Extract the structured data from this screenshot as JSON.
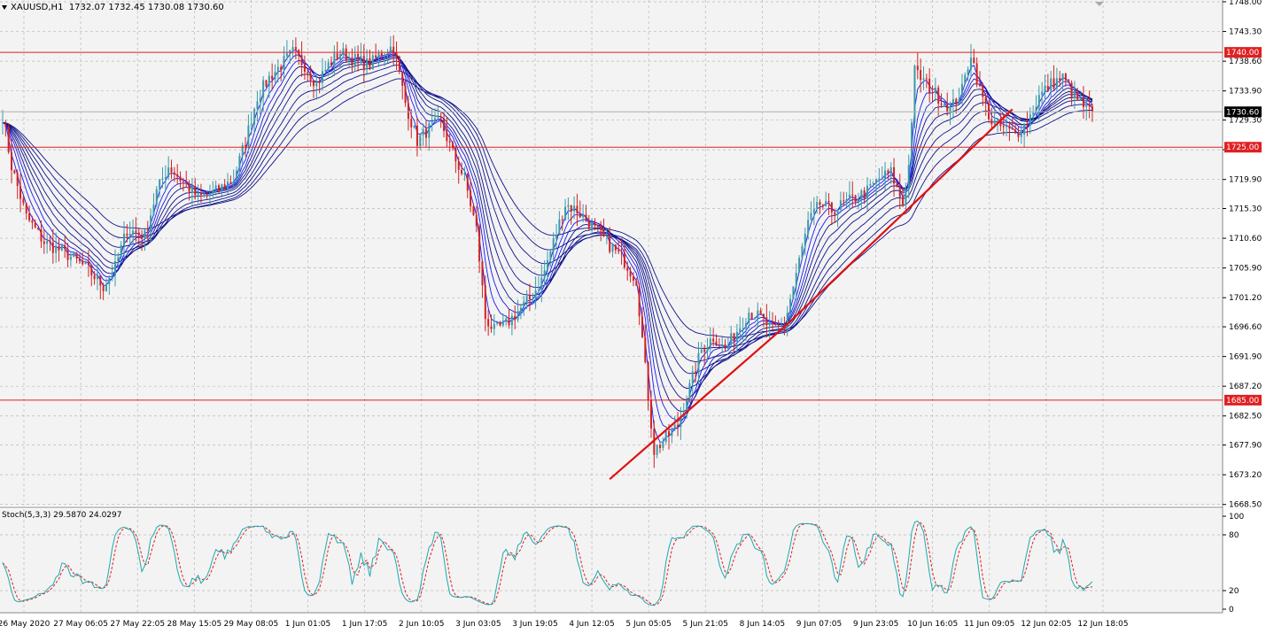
{
  "header": {
    "symbol": "XAUUSD,H1",
    "ohlc": "1732.07 1732.45 1730.08 1730.60"
  },
  "stoch_header": "Stoch(5,3,3) 29.5870 24.0297",
  "colors": {
    "background": "#f3f3f3",
    "grid": "#b9b9b9",
    "candle_up": "#3a9ba8",
    "candle_down": "#d22222",
    "ribbon": "#10128c",
    "fast_ma": "#1a1aee",
    "level_line": "#e02020",
    "trendline": "#e01010",
    "current_price": "#b0b0b0",
    "stoch_main": "#20a8b0",
    "stoch_signal": "#e02020"
  },
  "chart_data": [
    {
      "type": "line",
      "kind": "candlestick-with-ma-ribbon",
      "title": "",
      "price_axis": {
        "range": [
          1668.6,
          1748.0
        ],
        "ticks": [
          "1748.00",
          "1743.30",
          "1738.60",
          "1733.90",
          "1729.30",
          "1724.60",
          "1719.90",
          "1715.30",
          "1710.60",
          "1705.90",
          "1701.20",
          "1696.60",
          "1691.90",
          "1687.20",
          "1682.50",
          "1677.90",
          "1673.20",
          "1668.50"
        ]
      },
      "time_axis": {
        "labels": [
          "26 May 2020",
          "27 May 06:05",
          "27 May 22:05",
          "28 May 15:05",
          "29 May 08:05",
          "1 Jun 01:05",
          "1 Jun 17:05",
          "2 Jun 10:05",
          "3 Jun 03:05",
          "3 Jun 19:05",
          "4 Jun 12:05",
          "5 Jun 05:05",
          "5 Jun 21:05",
          "8 Jun 14:05",
          "9 Jun 07:05",
          "9 Jun 23:05",
          "10 Jun 16:05",
          "11 Jun 09:05",
          "12 Jun 02:05",
          "12 Jun 18:05"
        ]
      },
      "levels": [
        {
          "value": 1740.0,
          "label": "1740.00"
        },
        {
          "value": 1725.0,
          "label": "1725.00"
        },
        {
          "value": 1685.0,
          "label": "1685.00"
        }
      ],
      "current_price": {
        "value": 1730.6,
        "label": "1730.60"
      },
      "trendlines": [
        {
          "from": {
            "index": 0,
            "price": 1672.5
          },
          "to": {
            "index": 1,
            "price": 1697.0
          }
        },
        {
          "from": {
            "index": 1,
            "price": 1697.0
          },
          "to": {
            "index": 2,
            "price": 1731.0
          }
        }
      ],
      "price_path": [
        {
          "i": 0,
          "p": 1730.0
        },
        {
          "i": 3,
          "p": 1722.0
        },
        {
          "i": 8,
          "p": 1714.0
        },
        {
          "i": 14,
          "p": 1710.0
        },
        {
          "i": 22,
          "p": 1708.0
        },
        {
          "i": 28,
          "p": 1706.0
        },
        {
          "i": 34,
          "p": 1703.0
        },
        {
          "i": 38,
          "p": 1706.0
        },
        {
          "i": 42,
          "p": 1712.0
        },
        {
          "i": 48,
          "p": 1711.0
        },
        {
          "i": 52,
          "p": 1718.0
        },
        {
          "i": 56,
          "p": 1722.0
        },
        {
          "i": 60,
          "p": 1720.0
        },
        {
          "i": 66,
          "p": 1717.0
        },
        {
          "i": 72,
          "p": 1718.0
        },
        {
          "i": 78,
          "p": 1720.0
        },
        {
          "i": 82,
          "p": 1726.0
        },
        {
          "i": 86,
          "p": 1733.0
        },
        {
          "i": 90,
          "p": 1736.0
        },
        {
          "i": 94,
          "p": 1738.0
        },
        {
          "i": 98,
          "p": 1740.0
        },
        {
          "i": 102,
          "p": 1738.0
        },
        {
          "i": 106,
          "p": 1735.0
        },
        {
          "i": 110,
          "p": 1738.0
        },
        {
          "i": 114,
          "p": 1740.0
        },
        {
          "i": 118,
          "p": 1739.0
        },
        {
          "i": 124,
          "p": 1738.0
        },
        {
          "i": 128,
          "p": 1740.0
        },
        {
          "i": 132,
          "p": 1741.0
        },
        {
          "i": 136,
          "p": 1732.0
        },
        {
          "i": 140,
          "p": 1726.0
        },
        {
          "i": 144,
          "p": 1728.0
        },
        {
          "i": 148,
          "p": 1729.0
        },
        {
          "i": 152,
          "p": 1724.0
        },
        {
          "i": 156,
          "p": 1720.0
        },
        {
          "i": 160,
          "p": 1712.0
        },
        {
          "i": 163,
          "p": 1698.0
        },
        {
          "i": 166,
          "p": 1696.0
        },
        {
          "i": 170,
          "p": 1697.0
        },
        {
          "i": 174,
          "p": 1699.0
        },
        {
          "i": 178,
          "p": 1701.0
        },
        {
          "i": 182,
          "p": 1704.0
        },
        {
          "i": 186,
          "p": 1710.0
        },
        {
          "i": 190,
          "p": 1716.0
        },
        {
          "i": 194,
          "p": 1715.0
        },
        {
          "i": 198,
          "p": 1713.0
        },
        {
          "i": 202,
          "p": 1711.0
        },
        {
          "i": 206,
          "p": 1709.0
        },
        {
          "i": 210,
          "p": 1707.0
        },
        {
          "i": 214,
          "p": 1704.0
        },
        {
          "i": 217,
          "p": 1690.0
        },
        {
          "i": 220,
          "p": 1677.0
        },
        {
          "i": 224,
          "p": 1679.0
        },
        {
          "i": 228,
          "p": 1681.0
        },
        {
          "i": 232,
          "p": 1687.0
        },
        {
          "i": 236,
          "p": 1693.0
        },
        {
          "i": 240,
          "p": 1695.0
        },
        {
          "i": 244,
          "p": 1693.0
        },
        {
          "i": 248,
          "p": 1696.0
        },
        {
          "i": 252,
          "p": 1699.0
        },
        {
          "i": 256,
          "p": 1698.0
        },
        {
          "i": 260,
          "p": 1696.0
        },
        {
          "i": 264,
          "p": 1697.0
        },
        {
          "i": 268,
          "p": 1705.0
        },
        {
          "i": 272,
          "p": 1713.0
        },
        {
          "i": 276,
          "p": 1716.0
        },
        {
          "i": 280,
          "p": 1715.0
        },
        {
          "i": 284,
          "p": 1716.0
        },
        {
          "i": 288,
          "p": 1717.0
        },
        {
          "i": 292,
          "p": 1718.0
        },
        {
          "i": 296,
          "p": 1720.0
        },
        {
          "i": 300,
          "p": 1721.0
        },
        {
          "i": 304,
          "p": 1716.0
        },
        {
          "i": 306,
          "p": 1722.0
        },
        {
          "i": 308,
          "p": 1737.0
        },
        {
          "i": 312,
          "p": 1735.0
        },
        {
          "i": 316,
          "p": 1733.0
        },
        {
          "i": 320,
          "p": 1731.0
        },
        {
          "i": 324,
          "p": 1734.0
        },
        {
          "i": 327,
          "p": 1740.0
        },
        {
          "i": 330,
          "p": 1734.0
        },
        {
          "i": 334,
          "p": 1729.0
        },
        {
          "i": 338,
          "p": 1728.0
        },
        {
          "i": 342,
          "p": 1727.0
        },
        {
          "i": 346,
          "p": 1729.0
        },
        {
          "i": 350,
          "p": 1733.0
        },
        {
          "i": 354,
          "p": 1735.0
        },
        {
          "i": 358,
          "p": 1736.0
        },
        {
          "i": 362,
          "p": 1733.0
        },
        {
          "i": 366,
          "p": 1731.0
        },
        {
          "i": 368,
          "p": 1730.6
        }
      ]
    },
    {
      "type": "line",
      "kind": "stochastic-oscillator",
      "title": "Stoch(5,3,3)",
      "values_shown": [
        29.587,
        24.0297
      ],
      "range": [
        0,
        100
      ],
      "ticks": [
        "100",
        "80",
        "20",
        "0"
      ],
      "series": [
        {
          "name": "",
          "role": "main"
        },
        {
          "name": "",
          "role": "signal"
        }
      ]
    }
  ]
}
